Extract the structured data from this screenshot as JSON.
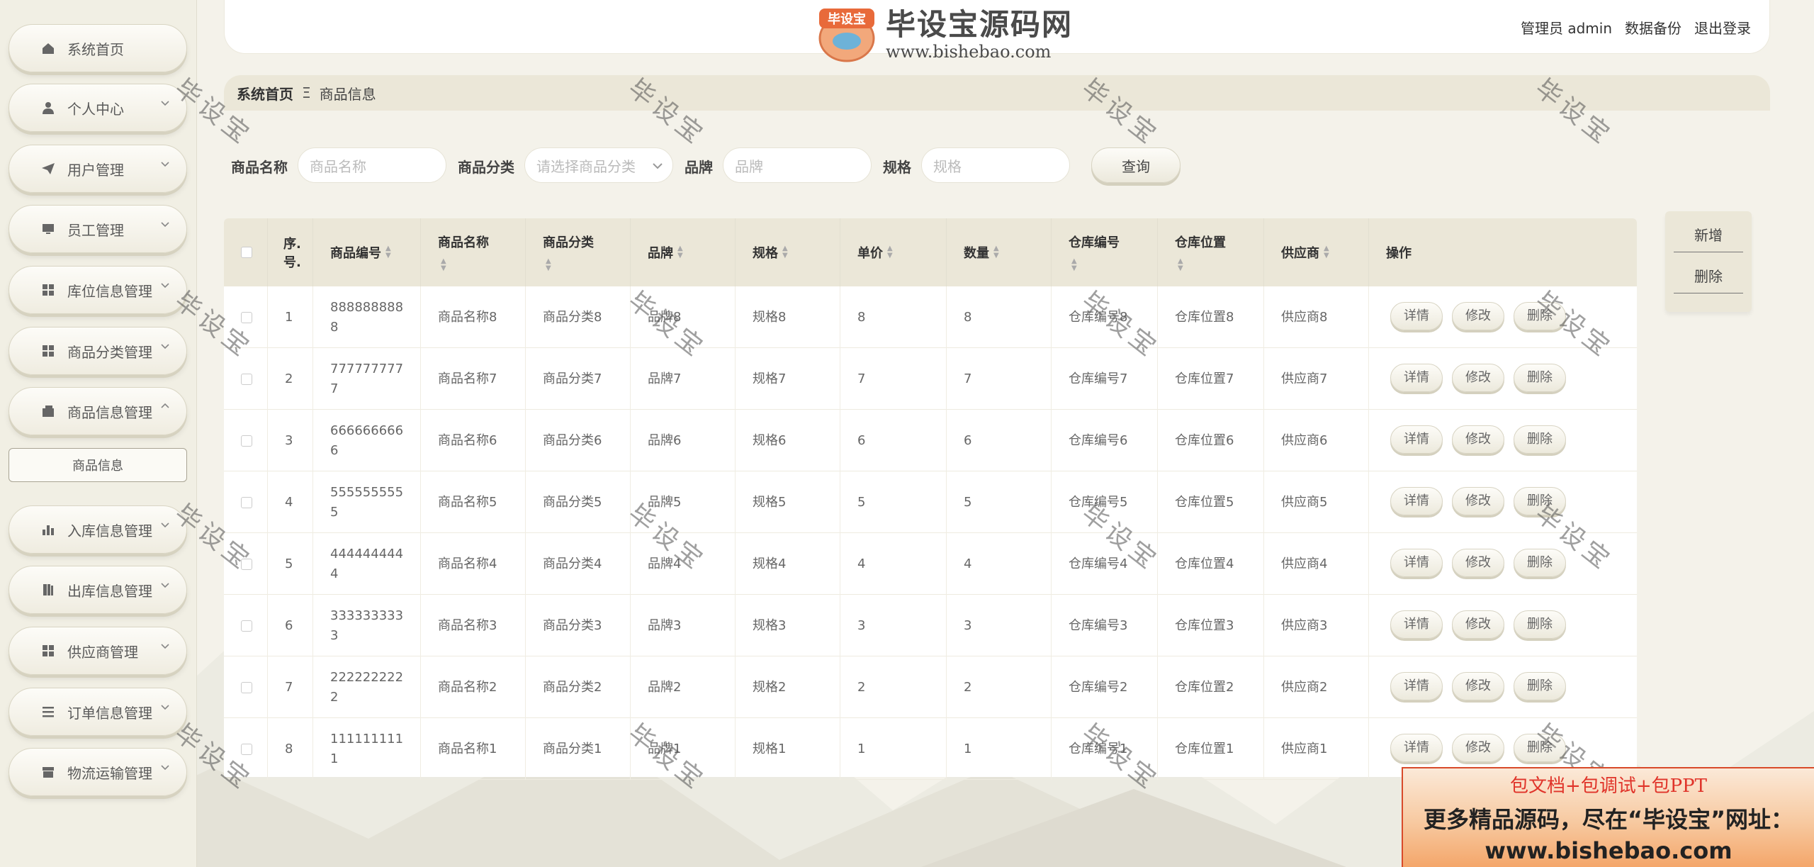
{
  "header": {
    "admin_text": "管理员 admin",
    "backup_link": "数据备份",
    "logout_link": "退出登录"
  },
  "watermark": {
    "title": "毕设宝源码网",
    "url": "www.bishebao.com",
    "seal_text": "毕设宝",
    "diagonal_text": "毕设宝"
  },
  "sidebar": {
    "items": [
      {
        "label": "系统首页",
        "icon": "home-icon"
      },
      {
        "label": "个人中心",
        "icon": "user-icon"
      },
      {
        "label": "用户管理",
        "icon": "paper-plane-icon"
      },
      {
        "label": "员工管理",
        "icon": "monitor-icon"
      },
      {
        "label": "库位信息管理",
        "icon": "grid-icon"
      },
      {
        "label": "商品分类管理",
        "icon": "grid-icon"
      },
      {
        "label": "商品信息管理",
        "icon": "wallet-icon"
      },
      {
        "label": "入库信息管理",
        "icon": "bar-chart-icon"
      },
      {
        "label": "出库信息管理",
        "icon": "book-icon"
      },
      {
        "label": "供应商管理",
        "icon": "grid-icon"
      },
      {
        "label": "订单信息管理",
        "icon": "list-icon"
      },
      {
        "label": "物流运输管理",
        "icon": "archive-icon"
      }
    ],
    "submenu_label": "商品信息"
  },
  "breadcrumb": {
    "home": "系统首页",
    "separator": "Ξ",
    "current": "商品信息"
  },
  "search": {
    "name_label": "商品名称",
    "name_placeholder": "商品名称",
    "category_label": "商品分类",
    "category_placeholder": "请选择商品分类",
    "brand_label": "品牌",
    "brand_placeholder": "品牌",
    "spec_label": "规格",
    "spec_placeholder": "规格",
    "query_button": "查询"
  },
  "actions": {
    "add": "新增",
    "delete": "删除"
  },
  "table": {
    "headers": [
      "序号.",
      "商品编号",
      "商品名称",
      "商品分类",
      "品牌",
      "规格",
      "单价",
      "数量",
      "仓库编号",
      "仓库位置",
      "供应商",
      "操作"
    ],
    "index_header_line1": "序.",
    "index_header_line2": "号.",
    "op_detail": "详情",
    "op_edit": "修改",
    "op_delete": "删除",
    "rows": [
      {
        "index": "1",
        "code_line1": "888888888",
        "code_line2": "8",
        "name": "商品名称8",
        "category": "商品分类8",
        "brand": "品牌8",
        "spec": "规格8",
        "price": "8",
        "quantity": "8",
        "warehouse_no": "仓库编号8",
        "warehouse_loc": "仓库位置8",
        "supplier": "供应商8"
      },
      {
        "index": "2",
        "code_line1": "777777777",
        "code_line2": "7",
        "name": "商品名称7",
        "category": "商品分类7",
        "brand": "品牌7",
        "spec": "规格7",
        "price": "7",
        "quantity": "7",
        "warehouse_no": "仓库编号7",
        "warehouse_loc": "仓库位置7",
        "supplier": "供应商7"
      },
      {
        "index": "3",
        "code_line1": "666666666",
        "code_line2": "6",
        "name": "商品名称6",
        "category": "商品分类6",
        "brand": "品牌6",
        "spec": "规格6",
        "price": "6",
        "quantity": "6",
        "warehouse_no": "仓库编号6",
        "warehouse_loc": "仓库位置6",
        "supplier": "供应商6"
      },
      {
        "index": "4",
        "code_line1": "555555555",
        "code_line2": "5",
        "name": "商品名称5",
        "category": "商品分类5",
        "brand": "品牌5",
        "spec": "规格5",
        "price": "5",
        "quantity": "5",
        "warehouse_no": "仓库编号5",
        "warehouse_loc": "仓库位置5",
        "supplier": "供应商5"
      },
      {
        "index": "5",
        "code_line1": "444444444",
        "code_line2": "4",
        "name": "商品名称4",
        "category": "商品分类4",
        "brand": "品牌4",
        "spec": "规格4",
        "price": "4",
        "quantity": "4",
        "warehouse_no": "仓库编号4",
        "warehouse_loc": "仓库位置4",
        "supplier": "供应商4"
      },
      {
        "index": "6",
        "code_line1": "333333333",
        "code_line2": "3",
        "name": "商品名称3",
        "category": "商品分类3",
        "brand": "品牌3",
        "spec": "规格3",
        "price": "3",
        "quantity": "3",
        "warehouse_no": "仓库编号3",
        "warehouse_loc": "仓库位置3",
        "supplier": "供应商3"
      },
      {
        "index": "7",
        "code_line1": "222222222",
        "code_line2": "2",
        "name": "商品名称2",
        "category": "商品分类2",
        "brand": "品牌2",
        "spec": "规格2",
        "price": "2",
        "quantity": "2",
        "warehouse_no": "仓库编号2",
        "warehouse_loc": "仓库位置2",
        "supplier": "供应商2"
      },
      {
        "index": "8",
        "code_line1": "111111111",
        "code_line2": "1",
        "name": "商品名称1",
        "category": "商品分类1",
        "brand": "品牌1",
        "spec": "规格1",
        "price": "1",
        "quantity": "1",
        "warehouse_no": "仓库编号1",
        "warehouse_loc": "仓库位置1",
        "supplier": "供应商1"
      }
    ]
  },
  "promo": {
    "line1": "包文档+包调试+包PPT",
    "line2": "更多精品源码，尽在“毕设宝”网址：",
    "line3": "www.bishebao.com"
  },
  "colors": {
    "theme_beige": "#ebe7d8",
    "promo_red": "#e0342a"
  }
}
